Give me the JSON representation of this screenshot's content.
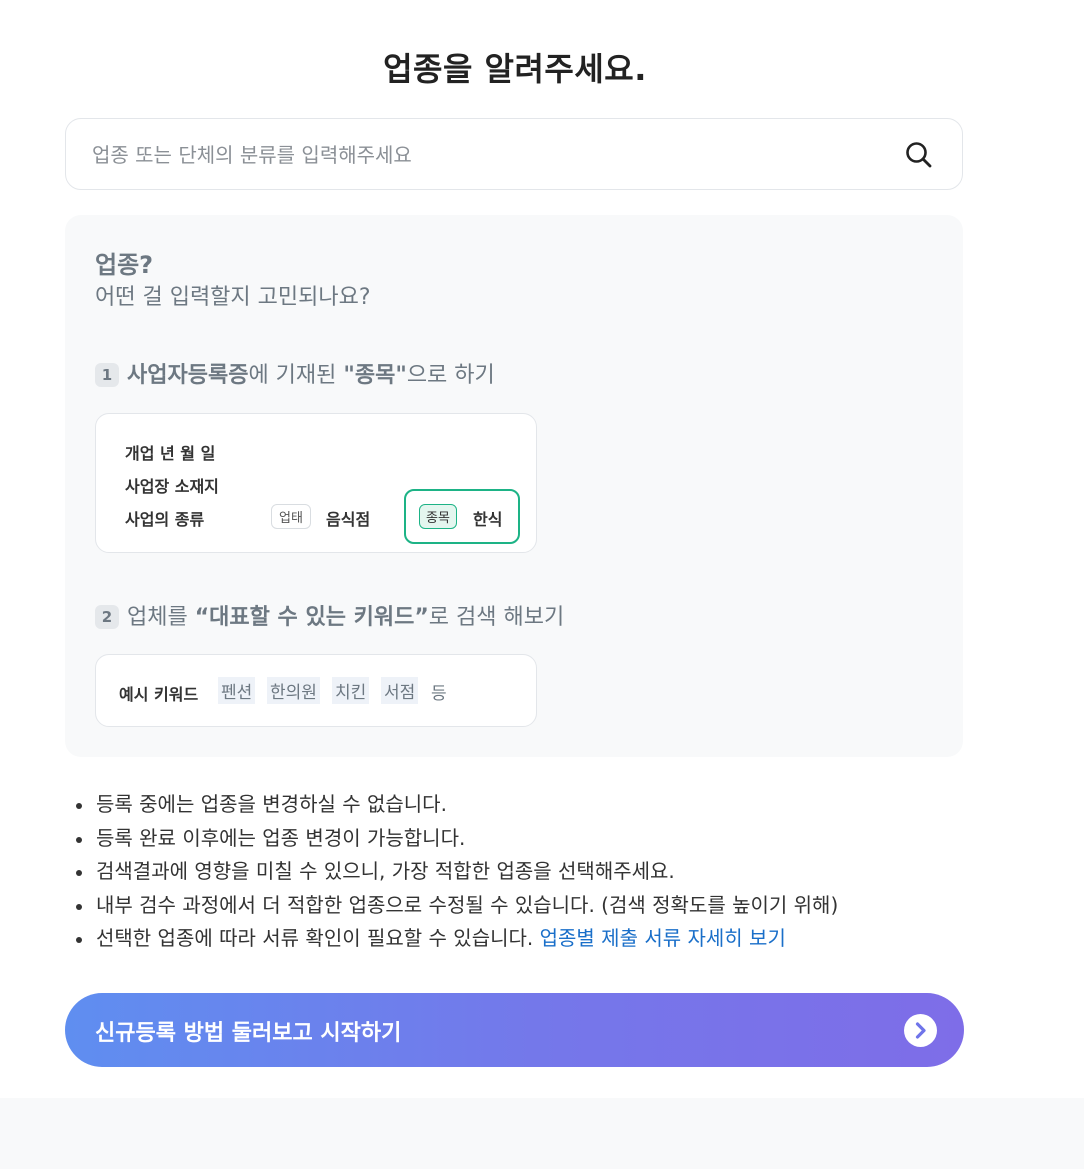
{
  "page": {
    "title": "업종을 알려주세요."
  },
  "search": {
    "placeholder": "업종 또는 단체의 분류를 입력해주세요"
  },
  "guide": {
    "title": "업종?",
    "subtitle": "어떤 걸 입력할지 고민되나요?",
    "step1": {
      "number": "1",
      "part1": "사업자등록증",
      "part2": "에 기재된 ",
      "part3": "\"종목\"",
      "part4": "으로 하기"
    },
    "card1": {
      "row1": "개업 년 월 일",
      "row2": "사업장 소재지",
      "row3": "사업의 종류",
      "chip_business_type": "업태",
      "business_type_value": "음식점",
      "chip_item": "종목",
      "item_value": "한식"
    },
    "step2": {
      "number": "2",
      "part1": "업체를 ",
      "part2": "“대표할 수 있는 키워드”",
      "part3": "로 검색 해보기"
    },
    "card2": {
      "label": "예시 키워드",
      "keywords": [
        "펜션",
        "한의원",
        "치킨",
        "서점"
      ],
      "etc": "등"
    }
  },
  "notes": [
    "등록 중에는 업종을 변경하실 수 없습니다.",
    "등록 완료 이후에는 업종 변경이 가능합니다.",
    "검색결과에 영향을 미칠 수 있으니, 가장 적합한 업종을 선택해주세요.",
    "내부 검수 과정에서 더 적합한 업종으로 수정될 수 있습니다. (검색 정확도를 높이기 위해)",
    "선택한 업종에 따라 서류 확인이 필요할 수 있습니다. "
  ],
  "notes_link": "업종별 제출 서류 자세히 보기",
  "cta": {
    "label": "신규등록 방법 둘러보고 시작하기",
    "icon": "chevron-right-circle-icon"
  },
  "colors": {
    "accent_green": "#1db386",
    "link": "#1a6fc9",
    "cta_start": "#5f8ef0",
    "cta_end": "#7e6de8"
  }
}
